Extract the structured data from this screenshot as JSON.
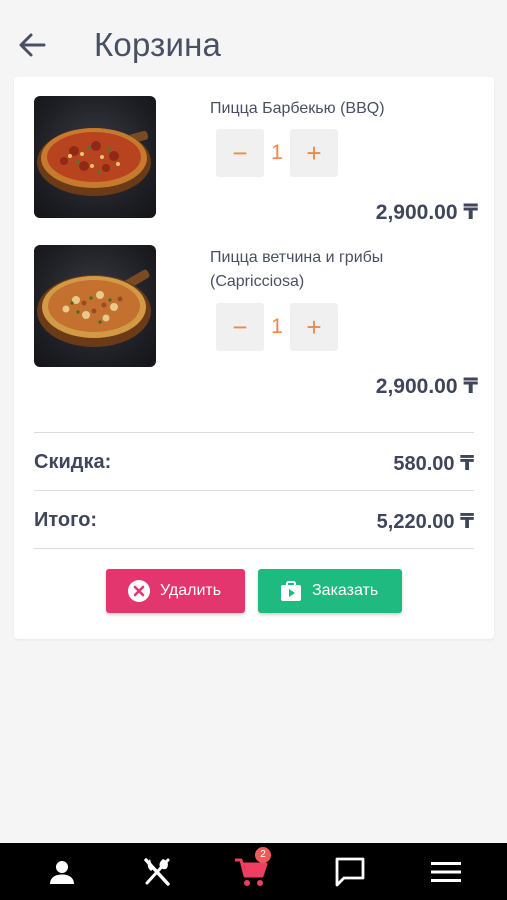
{
  "header": {
    "title": "Корзина"
  },
  "cart": {
    "items": [
      {
        "name": "Пицца Барбекью (BBQ)",
        "qty": "1",
        "price": "2,900.00 ₸",
        "minus": "−",
        "plus": "+"
      },
      {
        "name": "Пицца ветчина и грибы (Capricciosa)",
        "qty": "1",
        "price": "2,900.00 ₸",
        "minus": "−",
        "plus": "+"
      }
    ],
    "discount": {
      "label": "Скидка:",
      "value": "580.00 ₸"
    },
    "total": {
      "label": "Итого:",
      "value": "5,220.00 ₸"
    },
    "delete_label": "Удалить",
    "order_label": "Заказать"
  },
  "nav": {
    "cart_badge": "2"
  },
  "colors": {
    "delete": "#e3356e",
    "order": "#1fba7f",
    "accent": "#f2874a",
    "nav_bg": "#000000",
    "badge": "#f15a5a"
  }
}
